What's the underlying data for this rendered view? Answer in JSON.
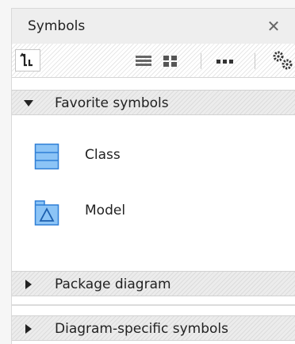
{
  "panel": {
    "title": "Symbols",
    "close_glyph": "✕"
  },
  "toolbar": {
    "buttons": [
      {
        "icon": "sort-icon",
        "active": true
      },
      {
        "icon": "list-view-icon"
      },
      {
        "icon": "grid-view-icon"
      },
      {
        "icon": "more-icon"
      },
      {
        "icon": "settings-icon"
      }
    ]
  },
  "sections": {
    "favorite": {
      "label": "Favorite symbols",
      "expanded": true
    },
    "package": {
      "label": "Package diagram",
      "expanded": false
    },
    "diagram_specific": {
      "label": "Diagram-specific symbols",
      "expanded": false
    }
  },
  "favorites": [
    {
      "label": "Class",
      "icon": "class-icon"
    },
    {
      "label": "Model",
      "icon": "model-icon"
    }
  ],
  "colors": {
    "icon_fill": "#7fbdf5",
    "icon_stroke": "#2f7fd6"
  }
}
